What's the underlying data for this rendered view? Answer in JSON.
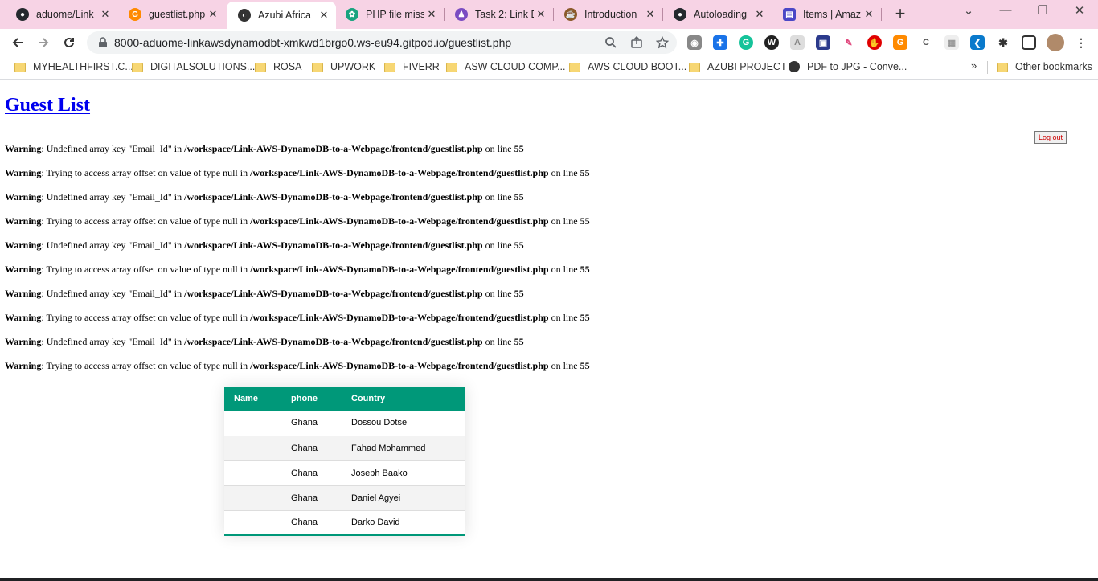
{
  "browser": {
    "tabs": [
      {
        "title": "aduome/Link",
        "favicon": "github-icon",
        "active": false
      },
      {
        "title": "guestlist.php",
        "favicon": "gitpod-icon",
        "active": false
      },
      {
        "title": "Azubi Africa",
        "favicon": "globe-icon",
        "active": true
      },
      {
        "title": "PHP file missi",
        "favicon": "chatgpt-icon",
        "active": false
      },
      {
        "title": "Task 2: Link D",
        "favicon": "task-icon",
        "active": false
      },
      {
        "title": "Introduction",
        "favicon": "intro-icon",
        "active": false
      },
      {
        "title": "Autoloading",
        "favicon": "github-icon",
        "active": false
      },
      {
        "title": "Items | Amaz",
        "favicon": "aws-icon",
        "active": false
      }
    ],
    "url": "8000-aduome-linkawsdynamodbt-xmkwd1brgo0.ws-eu94.gitpod.io/guestlist.php",
    "bookmarks": [
      {
        "label": "MYHEALTHFIRST.C...",
        "type": "folder"
      },
      {
        "label": "DIGITALSOLUTIONS...",
        "type": "folder"
      },
      {
        "label": "ROSA",
        "type": "folder"
      },
      {
        "label": "UPWORK",
        "type": "folder"
      },
      {
        "label": "FIVERR",
        "type": "folder"
      },
      {
        "label": "ASW CLOUD COMP...",
        "type": "folder"
      },
      {
        "label": "AWS CLOUD BOOT...",
        "type": "folder"
      },
      {
        "label": "AZUBI PROJECT",
        "type": "folder"
      },
      {
        "label": "PDF to JPG - Conve...",
        "type": "link"
      }
    ],
    "overflow": "»",
    "other_bookmarks": "Other bookmarks"
  },
  "page": {
    "title": "Guest List",
    "logout_label": "Log out",
    "warnings": [
      {
        "label": "Warning",
        "message": ": Undefined array key \"Email_Id\" in ",
        "file": "/workspace/Link-AWS-DynamoDB-to-a-Webpage/frontend/guestlist.php",
        "on_line": " on line ",
        "line": "55"
      },
      {
        "label": "Warning",
        "message": ": Trying to access array offset on value of type null in ",
        "file": "/workspace/Link-AWS-DynamoDB-to-a-Webpage/frontend/guestlist.php",
        "on_line": " on line ",
        "line": "55"
      },
      {
        "label": "Warning",
        "message": ": Undefined array key \"Email_Id\" in ",
        "file": "/workspace/Link-AWS-DynamoDB-to-a-Webpage/frontend/guestlist.php",
        "on_line": " on line ",
        "line": "55"
      },
      {
        "label": "Warning",
        "message": ": Trying to access array offset on value of type null in ",
        "file": "/workspace/Link-AWS-DynamoDB-to-a-Webpage/frontend/guestlist.php",
        "on_line": " on line ",
        "line": "55"
      },
      {
        "label": "Warning",
        "message": ": Undefined array key \"Email_Id\" in ",
        "file": "/workspace/Link-AWS-DynamoDB-to-a-Webpage/frontend/guestlist.php",
        "on_line": " on line ",
        "line": "55"
      },
      {
        "label": "Warning",
        "message": ": Trying to access array offset on value of type null in ",
        "file": "/workspace/Link-AWS-DynamoDB-to-a-Webpage/frontend/guestlist.php",
        "on_line": " on line ",
        "line": "55"
      },
      {
        "label": "Warning",
        "message": ": Undefined array key \"Email_Id\" in ",
        "file": "/workspace/Link-AWS-DynamoDB-to-a-Webpage/frontend/guestlist.php",
        "on_line": " on line ",
        "line": "55"
      },
      {
        "label": "Warning",
        "message": ": Trying to access array offset on value of type null in ",
        "file": "/workspace/Link-AWS-DynamoDB-to-a-Webpage/frontend/guestlist.php",
        "on_line": " on line ",
        "line": "55"
      },
      {
        "label": "Warning",
        "message": ": Undefined array key \"Email_Id\" in ",
        "file": "/workspace/Link-AWS-DynamoDB-to-a-Webpage/frontend/guestlist.php",
        "on_line": " on line ",
        "line": "55"
      },
      {
        "label": "Warning",
        "message": ": Trying to access array offset on value of type null in ",
        "file": "/workspace/Link-AWS-DynamoDB-to-a-Webpage/frontend/guestlist.php",
        "on_line": " on line ",
        "line": "55"
      }
    ],
    "table": {
      "headers": [
        "Name",
        "phone",
        "Country"
      ],
      "rows": [
        [
          "",
          "Ghana",
          "Dossou Dotse"
        ],
        [
          "",
          "Ghana",
          "Fahad Mohammed"
        ],
        [
          "",
          "Ghana",
          "Joseph Baako"
        ],
        [
          "",
          "Ghana",
          "Daniel Agyei"
        ],
        [
          "",
          "Ghana",
          "Darko David"
        ]
      ],
      "header_color": "#009879"
    }
  },
  "colors": {
    "tabstrip": "#f7d3e5",
    "link": "#0000ee",
    "accent": "#009879"
  }
}
